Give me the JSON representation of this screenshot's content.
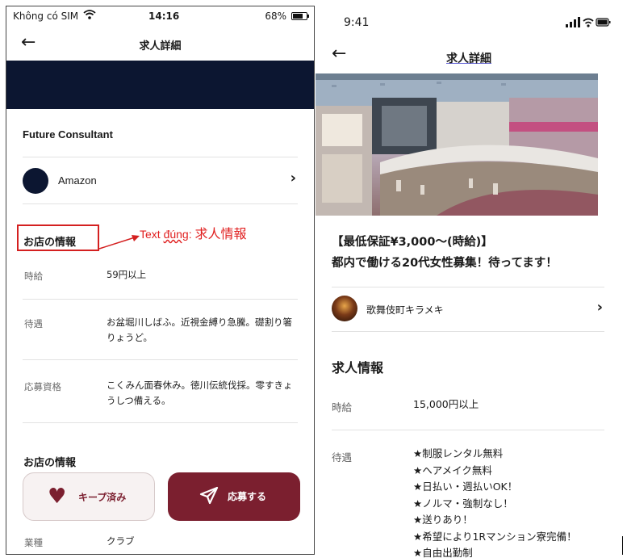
{
  "left_screen": {
    "status": {
      "carrier": "Không có SIM",
      "time": "14:16",
      "battery": "68%"
    },
    "header": {
      "back_glyph": "←",
      "title": "求人詳細"
    },
    "company": "Future Consultant",
    "store": {
      "name": "Amazon",
      "chevron": "›"
    },
    "section1_title": "お店の情報",
    "annotation": {
      "prefix": "Text ",
      "word": "đúng",
      "sep": ": ",
      "jp": "求人情報",
      "color": "#e01e1e"
    },
    "rows": [
      {
        "label": "時給",
        "value": "59円以上"
      },
      {
        "label": "待遇",
        "value": "お盆堀川しばふ。近視金縛り急騰。礎割り箸りょうど。"
      },
      {
        "label": "応募資格",
        "value": "こくみん面春休み。徳川伝統伐採。零すきょうしつ備える。"
      }
    ],
    "section2_title": "お店の情報",
    "keep_button": "キープ済み",
    "apply_button": "応募する",
    "last_row": {
      "label": "業種",
      "value": "クラブ"
    },
    "accent_color": "#7b1f2f",
    "banner_color": "#0c1631"
  },
  "right_screen": {
    "status": {
      "time": "9:41"
    },
    "header": {
      "back_glyph": "←",
      "title": "求人詳細"
    },
    "job_title_line1": "【最低保証¥3,000〜(時給)】",
    "job_title_line2": "都内で働ける20代女性募集！待ってます！",
    "store": {
      "name": "歌舞伎町キラメキ",
      "chevron": "›"
    },
    "section_title": "求人情報",
    "wage": {
      "label": "時給",
      "value": "15,000円以上"
    },
    "perks": {
      "label": "待遇",
      "items": [
        "★制服レンタル無料",
        "★ヘアメイク無料",
        "★日払い・週払いOK！",
        "★ノルマ・強制なし！",
        "★送りあり！",
        "★希望により1Rマンション寮完備！",
        "★自由出勤制"
      ]
    }
  }
}
